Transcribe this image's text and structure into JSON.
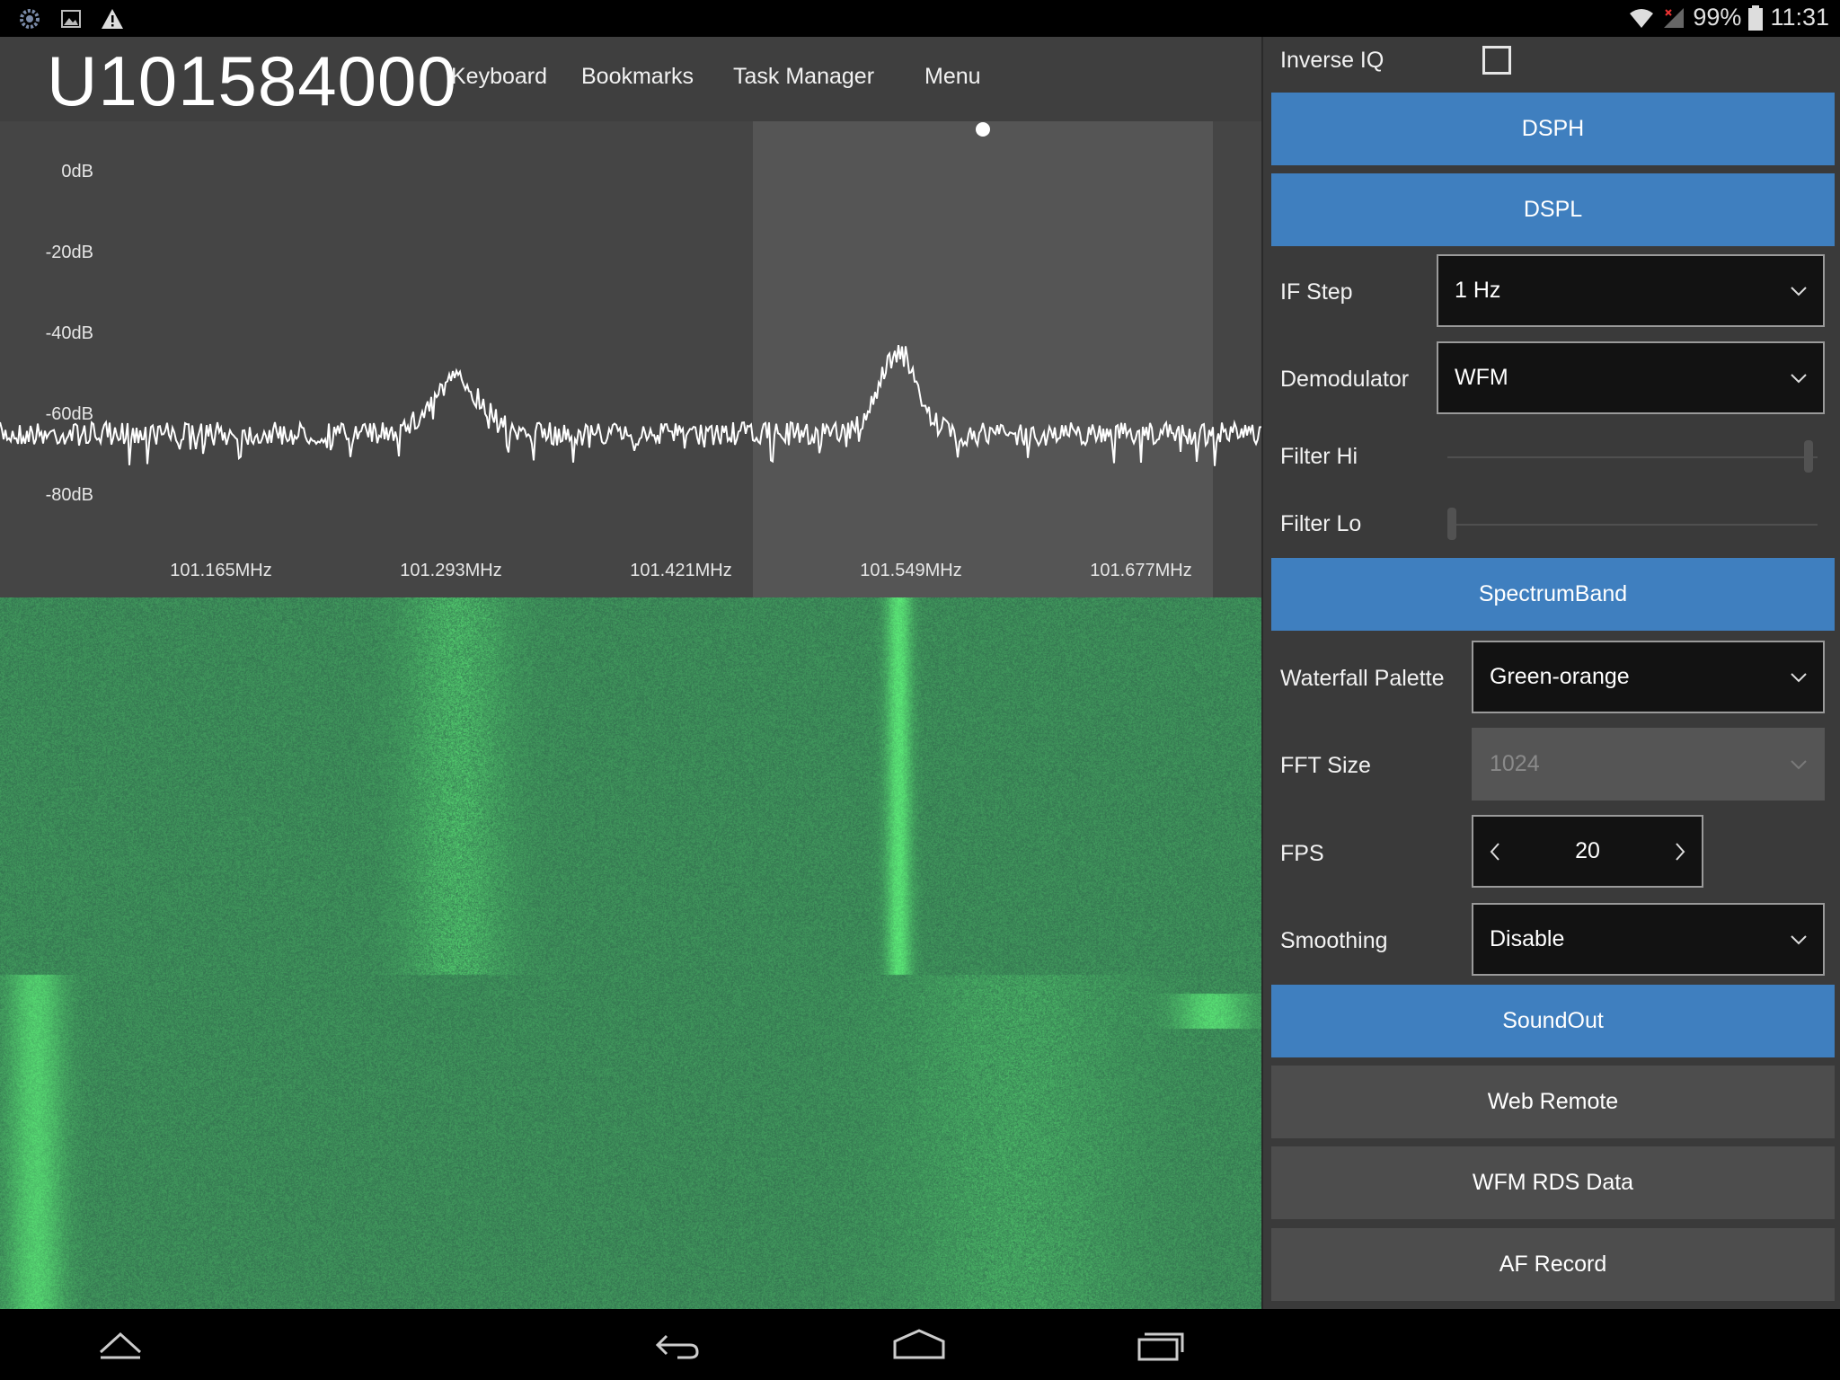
{
  "status_bar": {
    "battery": "99%",
    "time": "11:31",
    "icons_left": [
      "settings-icon",
      "image-icon",
      "warning-icon"
    ],
    "icons_right": [
      "wifi-icon",
      "signal-icon",
      "battery-icon"
    ]
  },
  "toolbar": {
    "frequency": "U101584000",
    "keyboard": "Keyboard",
    "bookmarks": "Bookmarks",
    "task_manager": "Task Manager",
    "menu": "Menu"
  },
  "spectrum": {
    "db_labels": [
      "0dB",
      "-20dB",
      "-40dB",
      "-60dB",
      "-80dB"
    ],
    "freq_labels": [
      "101.165MHz",
      "101.293MHz",
      "101.421MHz",
      "101.549MHz",
      "101.677MHz"
    ],
    "trace_color": "#ffffff",
    "highlight_color": "#555555"
  },
  "waterfall": {
    "palette": "Green-orange",
    "base_color": "#4a8a5a"
  },
  "settings": {
    "inverse_iq_label": "Inverse IQ",
    "inverse_iq_checked": false,
    "dsph": "DSPH",
    "dspl": "DSPL",
    "if_step_label": "IF Step",
    "if_step_value": "1 Hz",
    "demodulator_label": "Demodulator",
    "demodulator_value": "WFM",
    "filter_hi_label": "Filter Hi",
    "filter_lo_label": "Filter Lo",
    "filter_hi_level": 1.0,
    "filter_lo_level": 0.0,
    "spectrum_band": "SpectrumBand",
    "waterfall_palette_label": "Waterfall Palette",
    "waterfall_palette_value": "Green-orange",
    "fft_size_label": "FFT Size",
    "fft_size_value": "1024",
    "fps_label": "FPS",
    "fps_value": "20",
    "smoothing_label": "Smoothing",
    "smoothing_value": "Disable",
    "sound_out": "SoundOut",
    "web_remote": "Web Remote",
    "wfm_rds_data": "WFM RDS Data",
    "af_record": "AF Record"
  },
  "colors": {
    "accent_blue": "#3f7fbf",
    "panel_gray": "#3a3a3a"
  }
}
